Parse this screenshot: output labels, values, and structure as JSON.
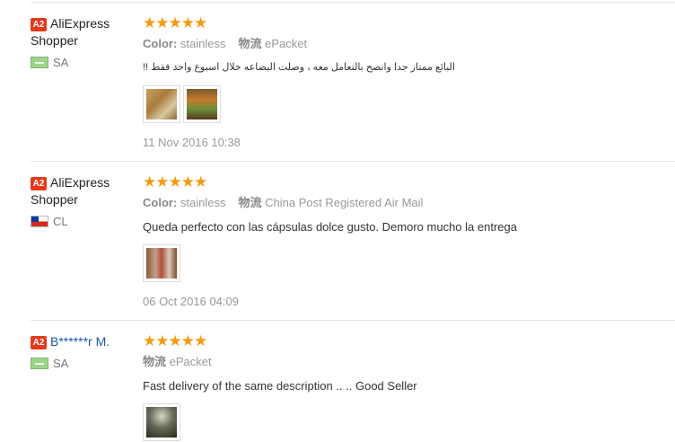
{
  "reviews": [
    {
      "badge": "A2",
      "buyer_name": "AliExpress Shopper",
      "country": "SA",
      "stars": "★★★★★",
      "color_label": "Color:",
      "color_value": "stainless",
      "shipping_label": "物流",
      "shipping_value": "ePacket",
      "feedback": "البائع ممتاز جدا وانصح بالتعامل معه ، وصلت البضاعه خلال اسبوع واحد فقط !!",
      "date": "11 Nov 2016 10:38"
    },
    {
      "badge": "A2",
      "buyer_name": "AliExpress Shopper",
      "country": "CL",
      "stars": "★★★★★",
      "color_label": "Color:",
      "color_value": "stainless",
      "shipping_label": "物流",
      "shipping_value": "China Post Registered Air Mail",
      "feedback": "Queda perfecto con las cápsulas dolce gusto. Demoro mucho la entrega",
      "date": "06 Oct 2016 04:09"
    },
    {
      "badge": "A2",
      "buyer_name": "B******r M.",
      "country": "SA",
      "stars": "★★★★★",
      "shipping_label": "物流",
      "shipping_value": "ePacket",
      "feedback": "Fast delivery of the same description .. .. Good Seller"
    }
  ],
  "colors": {
    "badge": "#e4391a",
    "stars": "#f39c12",
    "link_name": "#1a55a8"
  }
}
